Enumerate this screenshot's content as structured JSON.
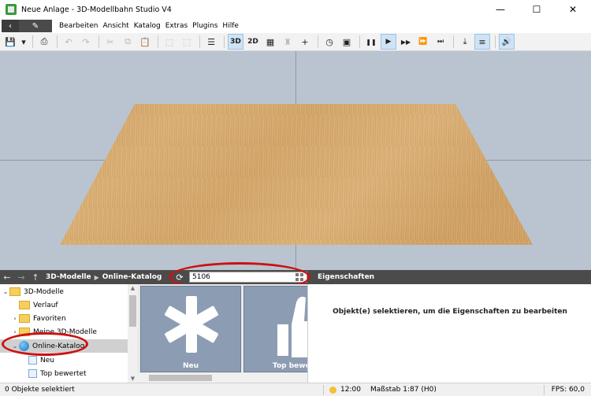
{
  "window": {
    "title": "Neue Anlage - 3D-Modellbahn Studio V4",
    "minimize": "—",
    "maximize": "☐",
    "close": "✕"
  },
  "menu": {
    "back_icon": "‹",
    "edit_icon": "✎",
    "items": [
      "Bearbeiten",
      "Ansicht",
      "Katalog",
      "Extras",
      "Plugins",
      "Hilfe"
    ]
  },
  "toolbar": {
    "view_3d": "3D",
    "view_2d": "2D",
    "icons": {
      "save": "💾",
      "dropdown": "▾",
      "print": "⎙",
      "undo": "↶",
      "redo": "↷",
      "cut": "✂",
      "copy": "⧉",
      "paste": "📋",
      "group": "⬚",
      "ungroup": "⬚",
      "list": "☰",
      "grid": "▦",
      "train": "♜",
      "plus": "+",
      "clock": "◷",
      "image": "▣",
      "pause": "❚❚",
      "play": "▶",
      "fast": "▶▶",
      "faster": "⏩",
      "end": "⏭",
      "download": "⤓",
      "track": "≡",
      "sound": "🔊"
    }
  },
  "catalog": {
    "nav_back": "←",
    "nav_forward": "→",
    "nav_up": "↑",
    "breadcrumb": [
      "3D-Modelle",
      "Online-Katalog"
    ],
    "refresh_icon": "⟳",
    "search_value": "5106",
    "properties_title": "Eigenschaften"
  },
  "tree": {
    "items": [
      {
        "label": "3D-Modelle",
        "expander": "⌄",
        "icon": "folder-icon"
      },
      {
        "label": "Verlauf",
        "expander": "",
        "icon": "folder-icon"
      },
      {
        "label": "Favoriten",
        "expander": "›",
        "icon": "folder-icon"
      },
      {
        "label": "Meine 3D-Modelle",
        "expander": "›",
        "icon": "folder-icon"
      },
      {
        "label": "Online-Katalog",
        "expander": "⌄",
        "icon": "globe-icon"
      },
      {
        "label": "Neu",
        "expander": "",
        "icon": "doc-icon"
      },
      {
        "label": "Top bewertet",
        "expander": "",
        "icon": "doc-icon"
      }
    ]
  },
  "thumbnails": [
    {
      "label": "Neu"
    },
    {
      "label": "Top bewer"
    }
  ],
  "properties": {
    "message": "Objekt(e) selektieren, um die Eigenschaften zu bearbeiten"
  },
  "status": {
    "selection": "0 Objekte selektiert",
    "time": "12:00",
    "scale": "Maßstab 1:87 (H0)",
    "fps": "FPS: 60,0"
  },
  "colors": {
    "viewport_bg": "#b9c4d0",
    "catalog_bar": "#4b4b4b",
    "highlight": "#cc1111",
    "active_button": "#cfe3f5"
  }
}
